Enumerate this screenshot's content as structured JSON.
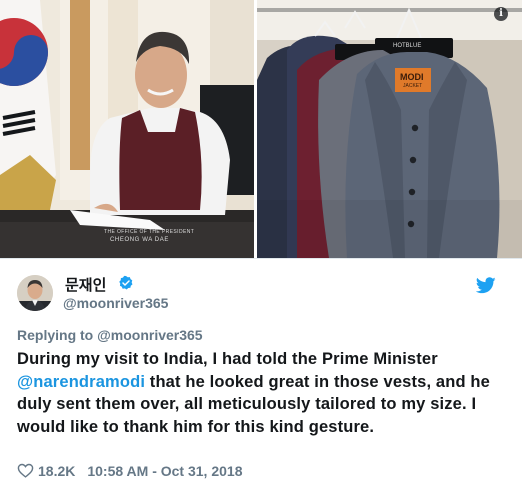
{
  "photos": {
    "left_caption_small": "THE OFFICE OF THE PRESIDENT",
    "left_caption": "CHEONG WA DAE",
    "right_tag_brand": "MODI",
    "right_tag_sub": "JACKET",
    "right_label": "HOTBLUE"
  },
  "tweet": {
    "display_name": "문재인",
    "handle": "@moonriver365",
    "reply_prefix": "Replying to",
    "reply_handle": "@moonriver365",
    "text_part1": "During my visit to India, I had told the Prime Minister ",
    "mention": "@narendramodi",
    "text_part2": " that he looked great in those vests, and he duly sent them over, all meticulously tailored to my size. I would like to thank him for this kind gesture.",
    "likes": "18.2K",
    "timestamp": "10:58 AM - Oct 31, 2018"
  },
  "colors": {
    "link_blue": "#1b95e0",
    "muted_gray": "#657786",
    "text_dark": "#14171a"
  },
  "icons": [
    "info-icon",
    "verified-icon",
    "twitter-bird-icon",
    "heart-icon"
  ]
}
